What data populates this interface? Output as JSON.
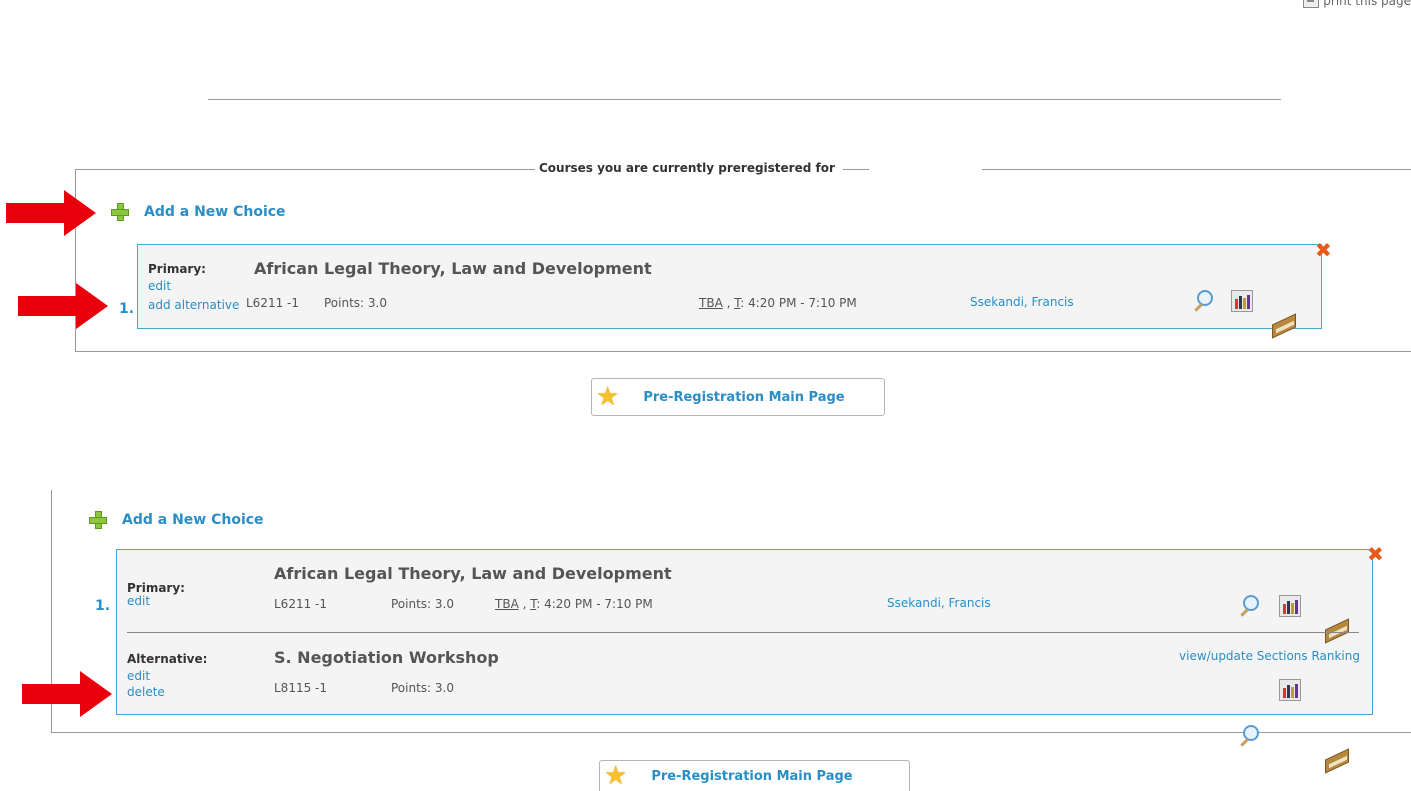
{
  "header": {
    "print_label": "print this page",
    "print_icon": "printer-icon"
  },
  "panel1": {
    "legend": "Courses you are currently preregistered for",
    "add_choice_label": "Add a New Choice",
    "course": {
      "number": "1.",
      "role_label": "Primary:",
      "title": "African Legal Theory, Law and Development",
      "edit_label": "edit",
      "add_alt_label": "add alternative",
      "code": "L6211 -1",
      "points": "Points: 3.0",
      "tba": "TBA",
      "sep": " , ",
      "day": "T",
      "time": ": 4:20 PM - 7:10 PM",
      "instructor": "Ssekandi, Francis"
    }
  },
  "main_button_label": "Pre-Registration Main Page",
  "panel2": {
    "add_choice_label": "Add a New Choice",
    "primary": {
      "number": "1.",
      "role_label": "Primary:",
      "title": "African Legal Theory, Law and Development",
      "edit_label": "edit",
      "code": "L6211 -1",
      "points": "Points: 3.0",
      "tba": "TBA",
      "sep": " , ",
      "day": "T",
      "time": ": 4:20 PM - 7:10 PM",
      "instructor": "Ssekandi, Francis"
    },
    "alternative": {
      "role_label": "Alternative:",
      "title": "S. Negotiation Workshop",
      "edit_label": "edit",
      "delete_label": "delete",
      "code": "L8115 -1",
      "points": "Points: 3.0",
      "ranking_link": "view/update Sections Ranking"
    }
  },
  "colors": {
    "accent": "#2a8ec6",
    "arrow": "#e8000b",
    "box_border": "#4aa6d1",
    "close": "#e85a1a",
    "plus": "#8cc63f"
  }
}
